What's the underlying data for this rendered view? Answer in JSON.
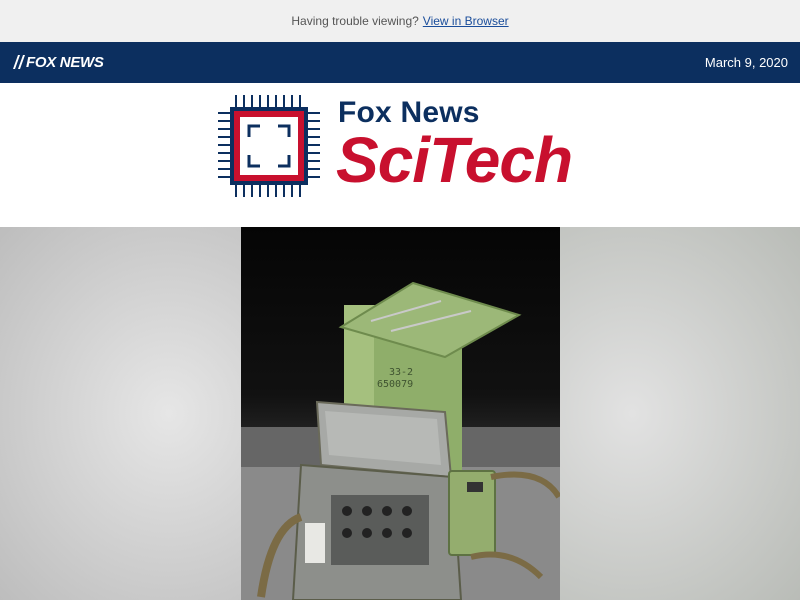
{
  "preheader": {
    "text": "Having trouble viewing?",
    "link": "View in Browser"
  },
  "topbar": {
    "logo_text": "FOX NEWS",
    "date": "March 9, 2020"
  },
  "masthead": {
    "brand_line1": "Fox News",
    "brand_line2": "SciTech"
  },
  "colors": {
    "navy": "#0c2f5f",
    "red": "#c8102e"
  },
  "hero": {
    "image_icon": "photo-icon"
  }
}
